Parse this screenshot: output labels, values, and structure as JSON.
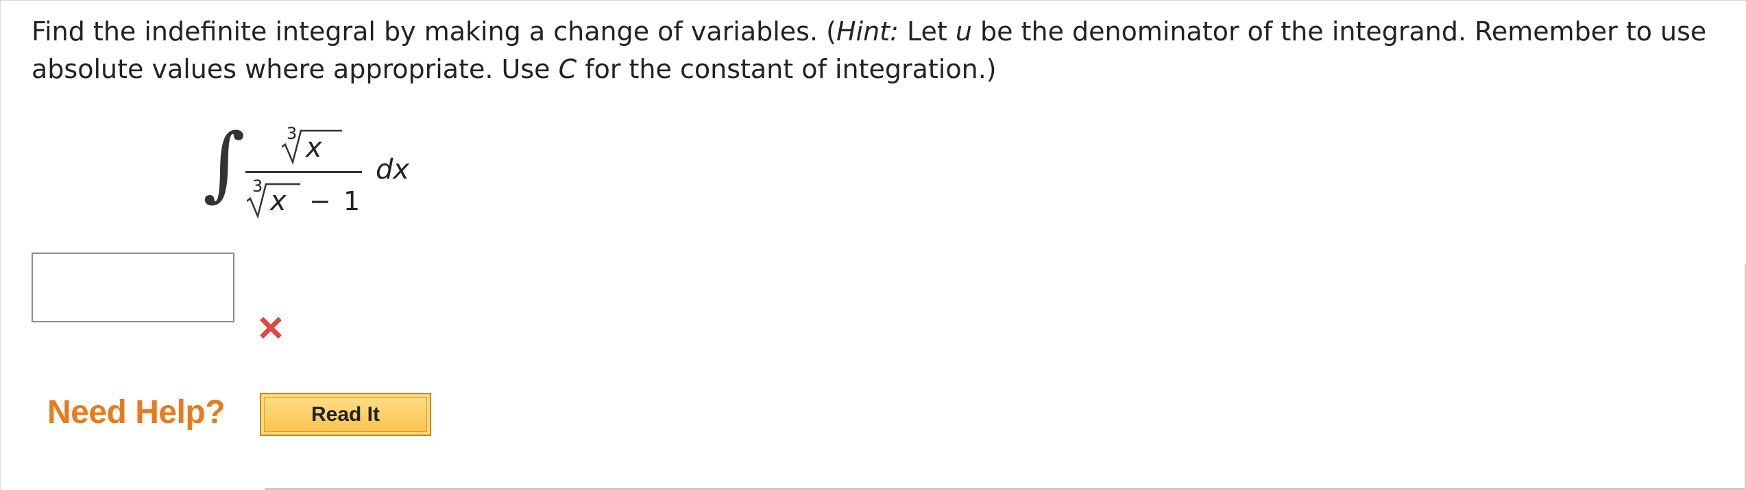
{
  "question": {
    "part1": "Find the indefinite integral by making a change of variables. (",
    "hint_label": "Hint:",
    "part2": " Let ",
    "var_u": "u",
    "part3": " be the denominator of the integrand. Remember to use absolute values where appropriate. Use ",
    "var_C": "C",
    "part4": " for the constant of integration.)"
  },
  "integral": {
    "sign": "∫",
    "numerator_root_index": "3",
    "numerator_var": "x",
    "denominator_root_index": "3",
    "denominator_var": "x",
    "denominator_minus": "−",
    "denominator_const": "1",
    "differential": "dx"
  },
  "answer": {
    "value": "",
    "status": "incorrect",
    "status_icon": "wrong-x-icon",
    "status_color": "#e8493f"
  },
  "help": {
    "label": "Need Help?",
    "read_it_label": "Read It",
    "label_color": "#e87b1b"
  }
}
